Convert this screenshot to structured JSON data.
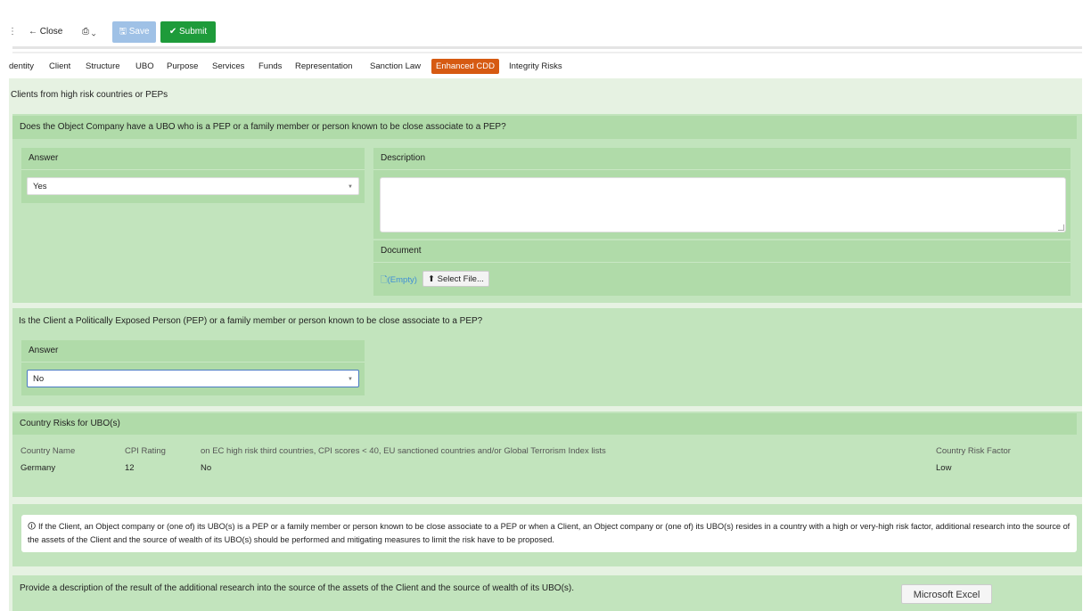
{
  "toolbar": {
    "menu_glyph": "⋮",
    "close_label": "← Close",
    "print_label": "⎙ ⌄",
    "save_label": "🖫 Save",
    "submit_label": "✔ Submit"
  },
  "tabs": [
    {
      "label": "dentity",
      "active": false
    },
    {
      "label": "Client",
      "active": false
    },
    {
      "label": "Structure",
      "active": false
    },
    {
      "label": "UBO",
      "active": false
    },
    {
      "label": "Purpose",
      "active": false
    },
    {
      "label": "Services",
      "active": false
    },
    {
      "label": "Funds",
      "active": false
    },
    {
      "label": "Representation",
      "active": false
    },
    {
      "label": "Sanction Law",
      "active": false
    },
    {
      "label": "Enhanced CDD",
      "active": true
    },
    {
      "label": "Integrity Risks",
      "active": false
    }
  ],
  "colors": {
    "active_tab": "#d65a12",
    "submit": "#1e9b3a",
    "save": "#9fc1e6",
    "panel": "#c2e4bd"
  },
  "section_title": "Clients from high risk countries or PEPs",
  "q1": {
    "question": "Does the Object Company have a UBO who is a PEP or a family member or person known to be close associate to a PEP?",
    "answer_label": "Answer",
    "answer_value": "Yes",
    "description_label": "Description",
    "description_value": "",
    "document_label": "Document",
    "document_value": "(Empty)",
    "select_file_label": "Select File..."
  },
  "q2": {
    "question": "Is the Client a Politically Exposed Person (PEP) or a family member or person known to be close associate to a PEP?",
    "answer_label": "Answer",
    "answer_value": "No"
  },
  "country_risks": {
    "title": "Country Risks for UBO(s)",
    "headers": [
      "Country Name",
      "CPI Rating",
      "on EC high risk third countries, CPI scores < 40, EU sanctioned countries and/or Global Terrorism Index lists",
      "Country Risk Factor"
    ],
    "rows": [
      [
        "Germany",
        "12",
        "No",
        "Low"
      ]
    ]
  },
  "info_text": "If the Client, an Object company or (one of) its UBO(s) is a PEP or a family member or person known to be close associate to a PEP or when a Client, an Object company or (one of) its UBO(s) resides in a country with a high or very-high risk factor, additional research into the source of the assets of the Client and the source of wealth of its UBO(s) should be performed and mitigating measures to limit the risk have to be proposed.",
  "q3_question": "Provide a description of the result of the additional research into the source of the assets of the Client and the source of wealth of its UBO(s).",
  "excel_label": "Microsoft Excel"
}
